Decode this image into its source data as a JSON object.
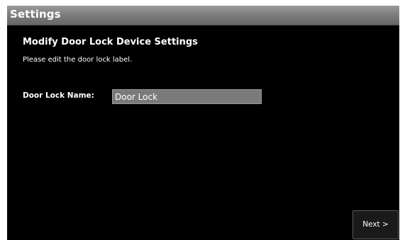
{
  "window": {
    "title": "Settings"
  },
  "main": {
    "heading": "Modify Door Lock Device Settings",
    "instructions": "Please edit the door lock label.",
    "door_lock_name": {
      "label": "Door Lock Name:",
      "value": "Door Lock"
    }
  },
  "footer": {
    "next_label": "Next >"
  },
  "colors": {
    "background": "#000000",
    "title_bar": "#7c7c7c",
    "input_background": "#7a7a7a",
    "text": "#ffffff"
  }
}
